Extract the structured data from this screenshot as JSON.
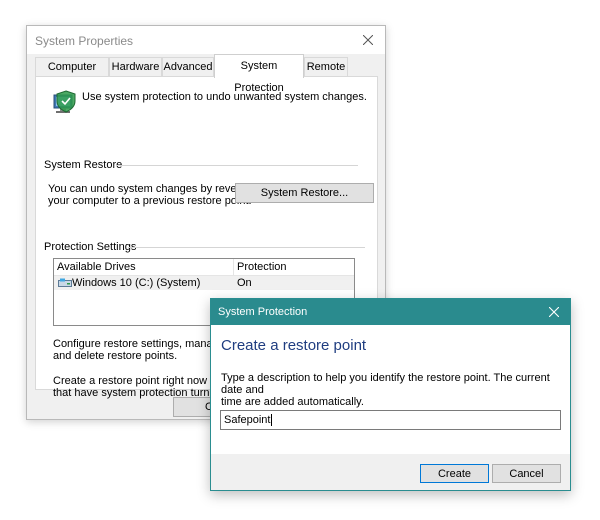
{
  "main_window": {
    "title": "System Properties",
    "tabs": [
      {
        "label": "Computer Name"
      },
      {
        "label": "Hardware"
      },
      {
        "label": "Advanced"
      },
      {
        "label": "System Protection",
        "active": true
      },
      {
        "label": "Remote"
      }
    ],
    "intro_text": "Use system protection to undo unwanted system changes.",
    "system_restore": {
      "group_label": "System Restore",
      "description_line1": "You can undo system changes by reverting",
      "description_line2": "your computer to a previous restore point.",
      "button_label": "System Restore..."
    },
    "protection_settings": {
      "group_label": "Protection Settings",
      "columns": [
        "Available Drives",
        "Protection"
      ],
      "rows": [
        {
          "drive": "Windows 10 (C:) (System)",
          "protection": "On"
        }
      ],
      "configure_line1": "Configure restore settings, manage di",
      "configure_line2": "and delete restore points.",
      "create_line1": "Create a restore point right now for th",
      "create_line2": "that have system protection turned on"
    },
    "ok_label": "OK"
  },
  "dialog": {
    "title": "System Protection",
    "heading": "Create a restore point",
    "description_line1": "Type a description to help you identify the restore point. The current date and",
    "description_line2": "time are added automatically.",
    "input_value": "Safepoint",
    "create_label": "Create",
    "cancel_label": "Cancel"
  },
  "colors": {
    "dialog_titlebar": "#2a8b8e",
    "dialog_heading": "#1f3d80",
    "button_default_border": "#0078d7"
  },
  "icons": [
    "close-icon",
    "shield-computer-icon",
    "drive-icon"
  ]
}
